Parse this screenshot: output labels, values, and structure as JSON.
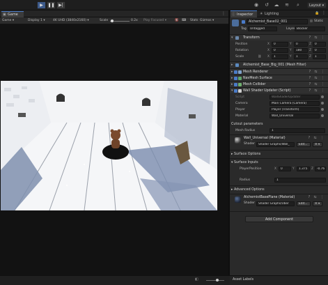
{
  "toolbar": {
    "play_icon": "play-icon",
    "pause_icon": "pause-icon",
    "step_icon": "step-icon",
    "layout_label": "Layout"
  },
  "game": {
    "tab_label": "Game",
    "display_mode": "Game",
    "display": "Display 1",
    "resolution": "4K UHD (3840x2160)",
    "scale_label": "Scale",
    "scale_value": "0.2x",
    "play_focused": "Play Focused",
    "stats_label": "Stats",
    "gizmos_label": "Gizmos"
  },
  "inspector": {
    "tab_label": "Inspector",
    "lighting_tab_label": "Lighting",
    "object_name": "Alchemist_Base02_001",
    "static_label": "Static",
    "tag_label": "Tag",
    "tag_value": "Untagged",
    "layer_label": "Layer",
    "layer_value": "Blocker",
    "transform": {
      "title": "Transform",
      "position_label": "Position",
      "position": {
        "x": "0",
        "y": "0",
        "z": "0"
      },
      "rotation_label": "Rotation",
      "rotation": {
        "x": "0",
        "y": "180",
        "z": "0"
      },
      "scale_label": "Scale",
      "scale": {
        "x": "1",
        "y": "1",
        "z": "1"
      }
    },
    "components": [
      {
        "name": "Alchemist_Base_Big_001 (Mesh Filter)"
      },
      {
        "name": "Mesh Renderer"
      },
      {
        "name": "NavMesh Surface"
      },
      {
        "name": "Mesh Collider"
      },
      {
        "name": "Wall Shader Updater (Script)"
      }
    ],
    "script": {
      "script_label": "Script",
      "script_value": "WallShaderUpdater",
      "camera_label": "Camera",
      "camera_value": "Main Camera (Camera)",
      "player_label": "Player",
      "player_value": "Player (Transform)",
      "material_label": "Material",
      "material_value": "Wall_Universal"
    },
    "cutout": {
      "title": "Cutout parameters",
      "mesh_radius_label": "Mesh Radius",
      "mesh_radius_value": "1"
    },
    "material1": {
      "name": "Wall_Universal (Material)",
      "shader_label": "Shader",
      "shader_value": "Shader Graphs/Wall_",
      "edit_label": "Edit..."
    },
    "surface_options": "Surface Options",
    "surface_inputs": "Surface Inputs",
    "player_position_label": "PlayerPosition",
    "player_position": {
      "x": "0",
      "y": "1.375",
      "z": "-0.76"
    },
    "radius_label": "Radius",
    "radius_value": "1",
    "advanced_options": "Advanced Options",
    "material2": {
      "name": "AlchemistBasePlane (Material)",
      "shader_label": "Shader",
      "shader_value": "Shader Graphs/Uber",
      "edit_label": "Edit..."
    },
    "add_component_label": "Add Component",
    "asset_labels": "Asset Labels"
  },
  "colors": {
    "accent": "#4a7bc7",
    "panel_bg": "#2a2a2a",
    "toolbar_bg": "#1e1e1e"
  }
}
